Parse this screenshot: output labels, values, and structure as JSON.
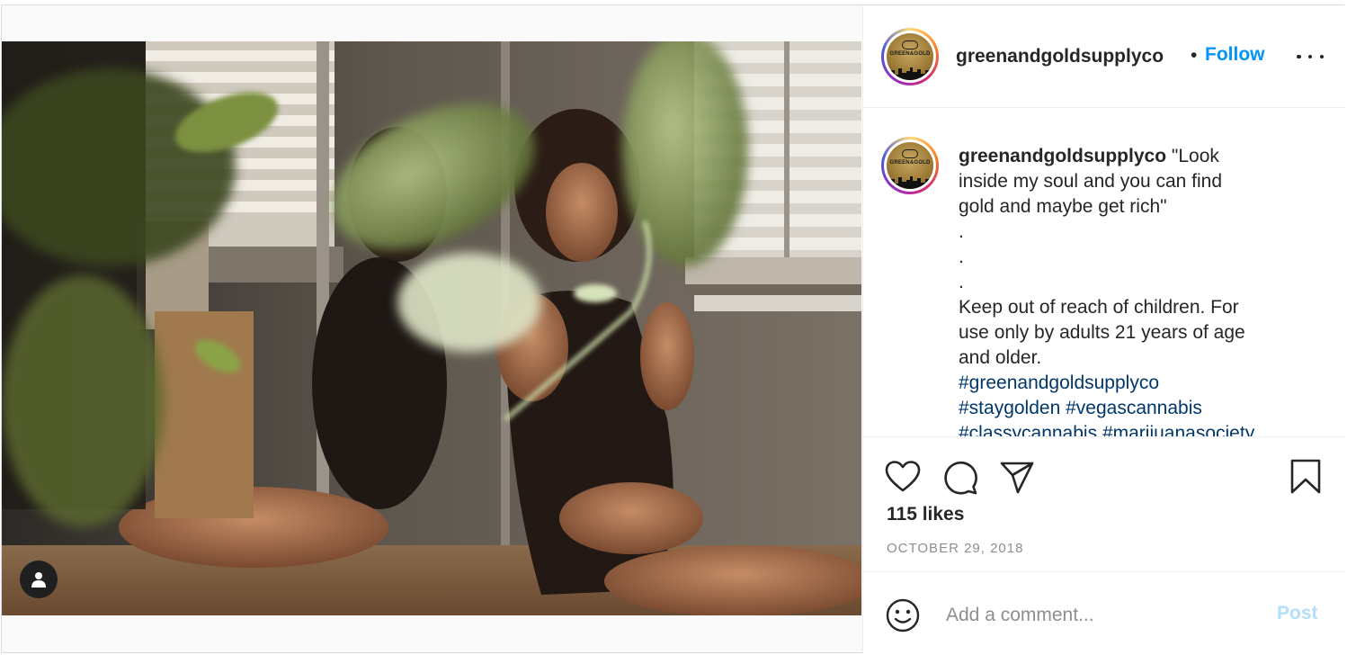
{
  "post": {
    "username": "greenandgoldsupplyco",
    "separator": "•",
    "follow_label": "Follow"
  },
  "caption": {
    "username": "greenandgoldsupplyco",
    "lines": [
      "\"Look",
      "inside my soul and you can find",
      "gold and maybe get rich\"",
      ".",
      ".",
      ".",
      "Keep out of reach of children. For",
      "use only by adults 21 years of age",
      "and older."
    ],
    "hashtags_line1": "#greenandgoldsupplyco",
    "hashtags_line2a": "#staygolden",
    "hashtags_line2b": "#vegascannabis",
    "hashtags_line3a": "#classycannabis",
    "hashtags_line3b": "#marijuanasociety"
  },
  "avatar": {
    "logo_text": "GREEN&GOLD"
  },
  "stats": {
    "likes": "115 likes",
    "date": "OCTOBER 29, 2018"
  },
  "comment": {
    "placeholder": "Add a comment...",
    "post_label": "Post"
  },
  "icons": {
    "like": "heart-icon",
    "comment": "comment-bubble-icon",
    "share": "paper-plane-icon",
    "save": "bookmark-icon",
    "emoji": "smiley-icon",
    "more": "more-horizontal-icon",
    "tagged": "user-tag-icon"
  },
  "colors": {
    "link": "#0095f6",
    "hashtag": "#00376b",
    "muted": "#8e8e8e",
    "post_disabled": "#b2dffc"
  }
}
